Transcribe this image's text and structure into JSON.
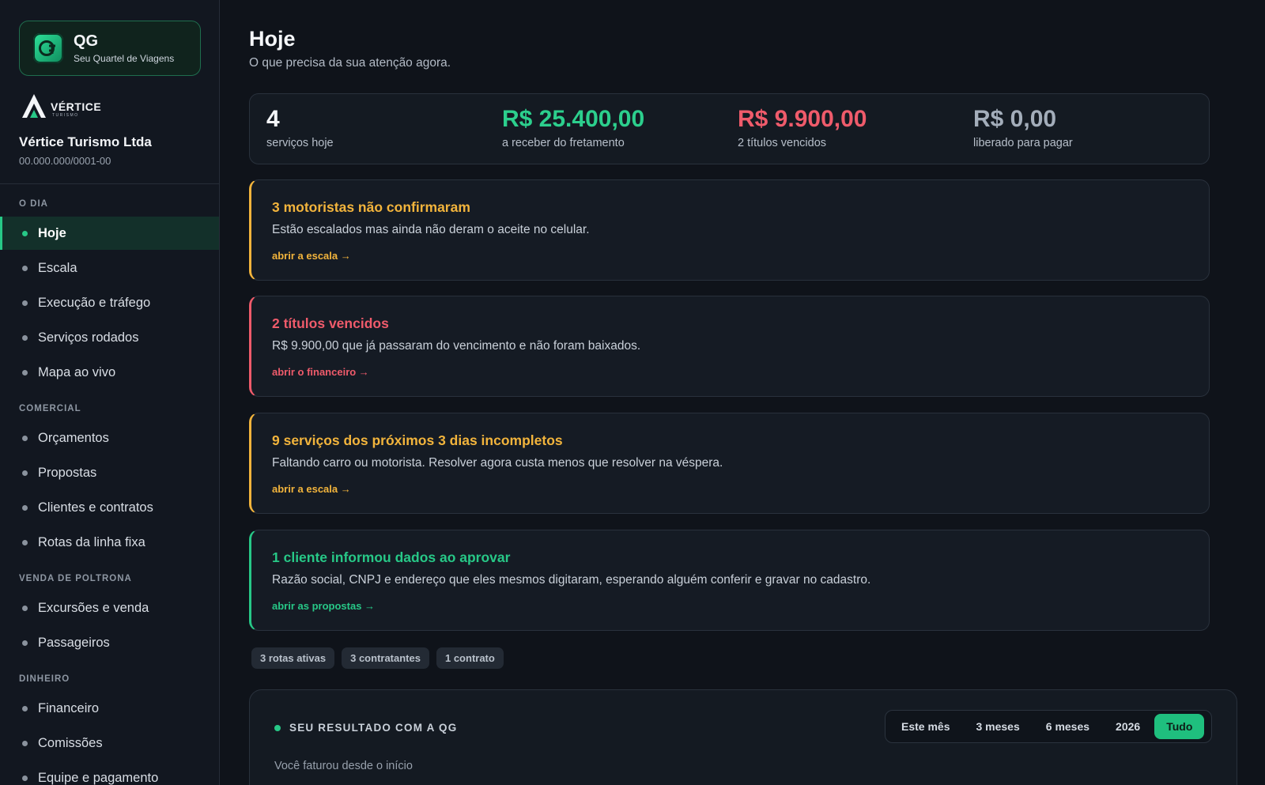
{
  "brand": {
    "name": "QG",
    "tagline": "Seu Quartel de Viagens"
  },
  "company": {
    "logo_name": "VÉRTICE",
    "logo_sub": "TURISMO",
    "name": "Vértice Turismo Ltda",
    "cnpj": "00.000.000/0001-00"
  },
  "nav": {
    "sections": [
      {
        "title": "O DIA",
        "items": [
          "Hoje",
          "Escala",
          "Execução e tráfego",
          "Serviços rodados",
          "Mapa ao vivo"
        ]
      },
      {
        "title": "COMERCIAL",
        "items": [
          "Orçamentos",
          "Propostas",
          "Clientes e contratos",
          "Rotas da linha fixa"
        ]
      },
      {
        "title": "VENDA DE POLTRONA",
        "items": [
          "Excursões e venda",
          "Passageiros"
        ]
      },
      {
        "title": "DINHEIRO",
        "items": [
          "Financeiro",
          "Comissões",
          "Equipe e pagamento"
        ]
      }
    ],
    "active": "Hoje"
  },
  "page": {
    "title": "Hoje",
    "subtitle": "O que precisa da sua atenção agora."
  },
  "stats": [
    {
      "value": "4",
      "label": "serviços hoje",
      "color": "#f3f5f8"
    },
    {
      "value": "R$ 25.400,00",
      "label": "a receber do fretamento",
      "color": "#2ccf8d"
    },
    {
      "value": "R$ 9.900,00",
      "label": "2 títulos vencidos",
      "color": "#ef5b6b"
    },
    {
      "value": "R$ 0,00",
      "label": "liberado para pagar",
      "color": "#a3adba"
    }
  ],
  "alerts": [
    {
      "title": "3 motoristas não confirmaram",
      "desc": "Estão escalados mas ainda não deram o aceite no celular.",
      "link": "abrir a escala →",
      "color": "#f2b43c"
    },
    {
      "title": "2 títulos vencidos",
      "desc": "R$ 9.900,00 que já passaram do vencimento e não foram baixados.",
      "link": "abrir o financeiro →",
      "color": "#ef5b6b"
    },
    {
      "title": "9 serviços dos próximos 3 dias incompletos",
      "desc": "Faltando carro ou motorista. Resolver agora custa menos que resolver na véspera.",
      "link": "abrir a escala →",
      "color": "#f2b43c"
    },
    {
      "title": "1 cliente informou dados ao aprovar",
      "desc": "Razão social, CNPJ e endereço que eles mesmos digitaram, esperando alguém conferir e gravar no cadastro.",
      "link": "abrir as propostas →",
      "color": "#27c887"
    }
  ],
  "chips": [
    "3 rotas ativas",
    "3 contratantes",
    "1 contrato"
  ],
  "result": {
    "title": "SEU RESULTADO COM A QG",
    "periods": [
      "Este mês",
      "3 meses",
      "6 meses",
      "2026",
      "Tudo"
    ],
    "active_period": "Tudo",
    "subtitle": "Você faturou desde o início"
  }
}
